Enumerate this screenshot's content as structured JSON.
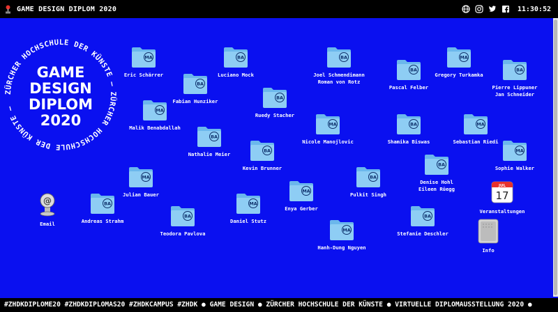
{
  "topbar": {
    "title": "GAME DESIGN DIPLOM 2020",
    "icons": [
      "globe-icon",
      "instagram-icon",
      "twitter-icon",
      "facebook-icon"
    ],
    "clock": "11:30:52"
  },
  "seal": {
    "main_lines": [
      "GAME",
      "DESIGN",
      "DIPLOM",
      "2020"
    ],
    "ring_text": "ZÜRCHER HOCHSCHULE DER KÜNSTE – ZÜRCHER HOCHSCHULE DER KÜNSTE – "
  },
  "folders": [
    {
      "badge": "MA",
      "name": "Eric Schärrer"
    },
    {
      "badge": "BA",
      "name": "Luciano Mock"
    },
    {
      "badge": "BA",
      "name": "Joel Schmendimann\nRoman von Rotz"
    },
    {
      "badge": "MA",
      "name": "Gregory Turkamka"
    },
    {
      "badge": "BA",
      "name": "Pascal Felber"
    },
    {
      "badge": "BA",
      "name": "Pierre Lippuner\nJan Schneider"
    },
    {
      "badge": "BA",
      "name": "Fabian Hunziker"
    },
    {
      "badge": "BA",
      "name": "Ruedy Stacher"
    },
    {
      "badge": "MA",
      "name": "Malik Benabdallah"
    },
    {
      "badge": "BA",
      "name": "Nathalie Meier"
    },
    {
      "badge": "MA",
      "name": "Nicole Manojlovic"
    },
    {
      "badge": "BA",
      "name": "Shamika Biswas"
    },
    {
      "badge": "MA",
      "name": "Sebastian Riedi"
    },
    {
      "badge": "BA",
      "name": "Kevin Brunner"
    },
    {
      "badge": "MA",
      "name": "Sophie Walker"
    },
    {
      "badge": "BA",
      "name": "Denise Hohl\nEileen Rüegg"
    },
    {
      "badge": "MA",
      "name": "Julian Bauer"
    },
    {
      "badge": "BA",
      "name": "Pulkit Singh"
    },
    {
      "badge": "BA",
      "name": "Andreas Strahm"
    },
    {
      "badge": "MA",
      "name": "Enya Gerber"
    },
    {
      "badge": "MA",
      "name": "Daniel Stutz"
    },
    {
      "badge": "BA",
      "name": "Teodora Pavlova"
    },
    {
      "badge": "BA",
      "name": "Stefanie Deschler"
    },
    {
      "badge": "MA",
      "name": "Hanh-Dung Nguyen"
    }
  ],
  "apps": {
    "email": {
      "label": "Email"
    },
    "events": {
      "label": "Veranstaltungen",
      "cal_month": "JUL",
      "cal_day": "17"
    },
    "info": {
      "label": "Info"
    }
  },
  "footer": {
    "ticker": "#ZHDKDIPLOME20 #ZHDKDIPLOMAS20 #ZHDKCAMPUS #ZHDK  ●  GAME DESIGN  ●  ZÜRCHER HOCHSCHULE DER KÜNSTE  ●  VIRTUELLE DIPLOMAUSSTELLUNG 2020  ●"
  },
  "colors": {
    "background": "#0a10f0",
    "folder": "#8ecdf4",
    "folder_tab": "#6bb7ec",
    "bar": "#000000"
  }
}
